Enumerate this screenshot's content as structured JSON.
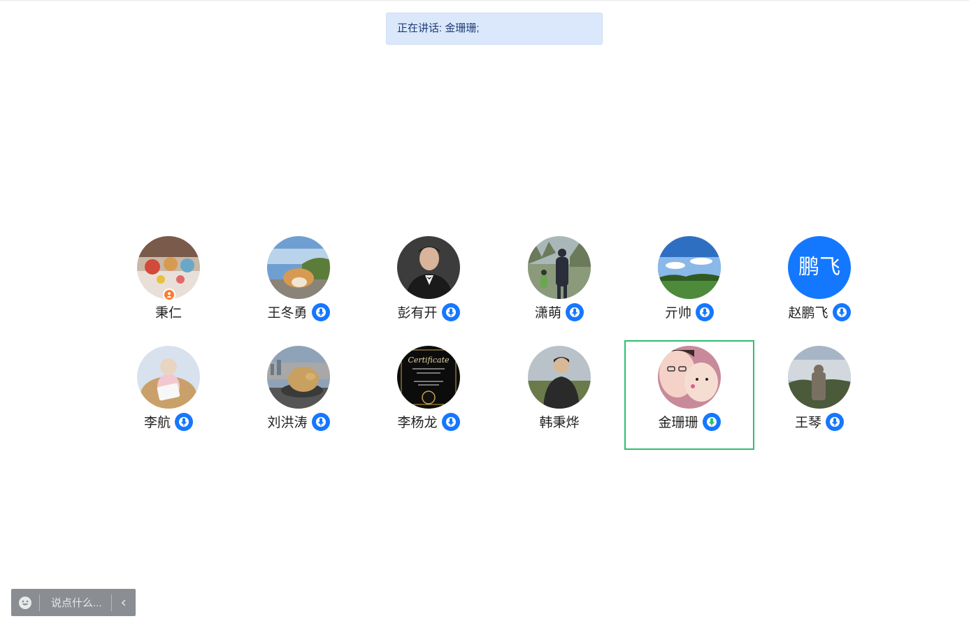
{
  "banner": {
    "text": "正在讲话: 金珊珊;"
  },
  "participants": [
    {
      "name": "秉仁",
      "mic": false,
      "host": true,
      "avatar": "photo-toys",
      "palette": [
        "#c8b8a8",
        "#7a5a4a",
        "#e8e0d8",
        "#d24a3a"
      ]
    },
    {
      "name": "王冬勇",
      "mic": true,
      "avatar": "photo-shiba",
      "palette": [
        "#6f9fd0",
        "#b9d4ea",
        "#5c7c3a",
        "#d79a52"
      ]
    },
    {
      "name": "彭有开",
      "mic": true,
      "avatar": "photo-portrait",
      "palette": [
        "#3c3c3c",
        "#1a1a1a",
        "#d7b49a",
        "#f2f2f2"
      ]
    },
    {
      "name": "潇萌",
      "mic": true,
      "avatar": "photo-walk",
      "palette": [
        "#aab7b8",
        "#6a7a5a",
        "#2a2d3a",
        "#8a9a7a"
      ]
    },
    {
      "name": "亓帅",
      "mic": true,
      "avatar": "photo-sky",
      "palette": [
        "#2f6fc2",
        "#8ab8e8",
        "#ffffff",
        "#4d8a3a"
      ]
    },
    {
      "name": "赵鹏飞",
      "mic": true,
      "avatar": "text",
      "avatar_text": "鹏飞",
      "palette": [
        "#1478ff"
      ]
    },
    {
      "name": "李航",
      "mic": true,
      "avatar": "photo-baby",
      "palette": [
        "#d8e2ee",
        "#caa06a",
        "#f3c7cf",
        "#e8d4c0"
      ]
    },
    {
      "name": "刘洪涛",
      "mic": true,
      "avatar": "photo-pig",
      "palette": [
        "#8fa3b8",
        "#a8a8a8",
        "#c8a060",
        "#3a3a3a"
      ]
    },
    {
      "name": "李杨龙",
      "mic": true,
      "avatar": "photo-certificate",
      "palette": [
        "#0c0c0c",
        "#1a1a1a",
        "#c9a24a",
        "#e8d8a8"
      ]
    },
    {
      "name": "韩秉烨",
      "mic": false,
      "avatar": "photo-man",
      "palette": [
        "#b8c2c8",
        "#6a7a4a",
        "#2a2a2a",
        "#d8b898"
      ]
    },
    {
      "name": "金珊珊",
      "mic": true,
      "speaking": true,
      "avatar": "photo-selfie",
      "palette": [
        "#c88a9a",
        "#f4d2c8",
        "#3a2a2a",
        "#e85a8a"
      ]
    },
    {
      "name": "王琴",
      "mic": true,
      "avatar": "photo-statue",
      "palette": [
        "#a7b6c6",
        "#d2d8de",
        "#7a7062",
        "#4a5a3a"
      ]
    }
  ],
  "chat": {
    "placeholder": "说点什么..."
  },
  "colors": {
    "accent": "#1677ff",
    "speaking_border": "#2fbf71",
    "banner_bg": "#dbe8fb"
  }
}
